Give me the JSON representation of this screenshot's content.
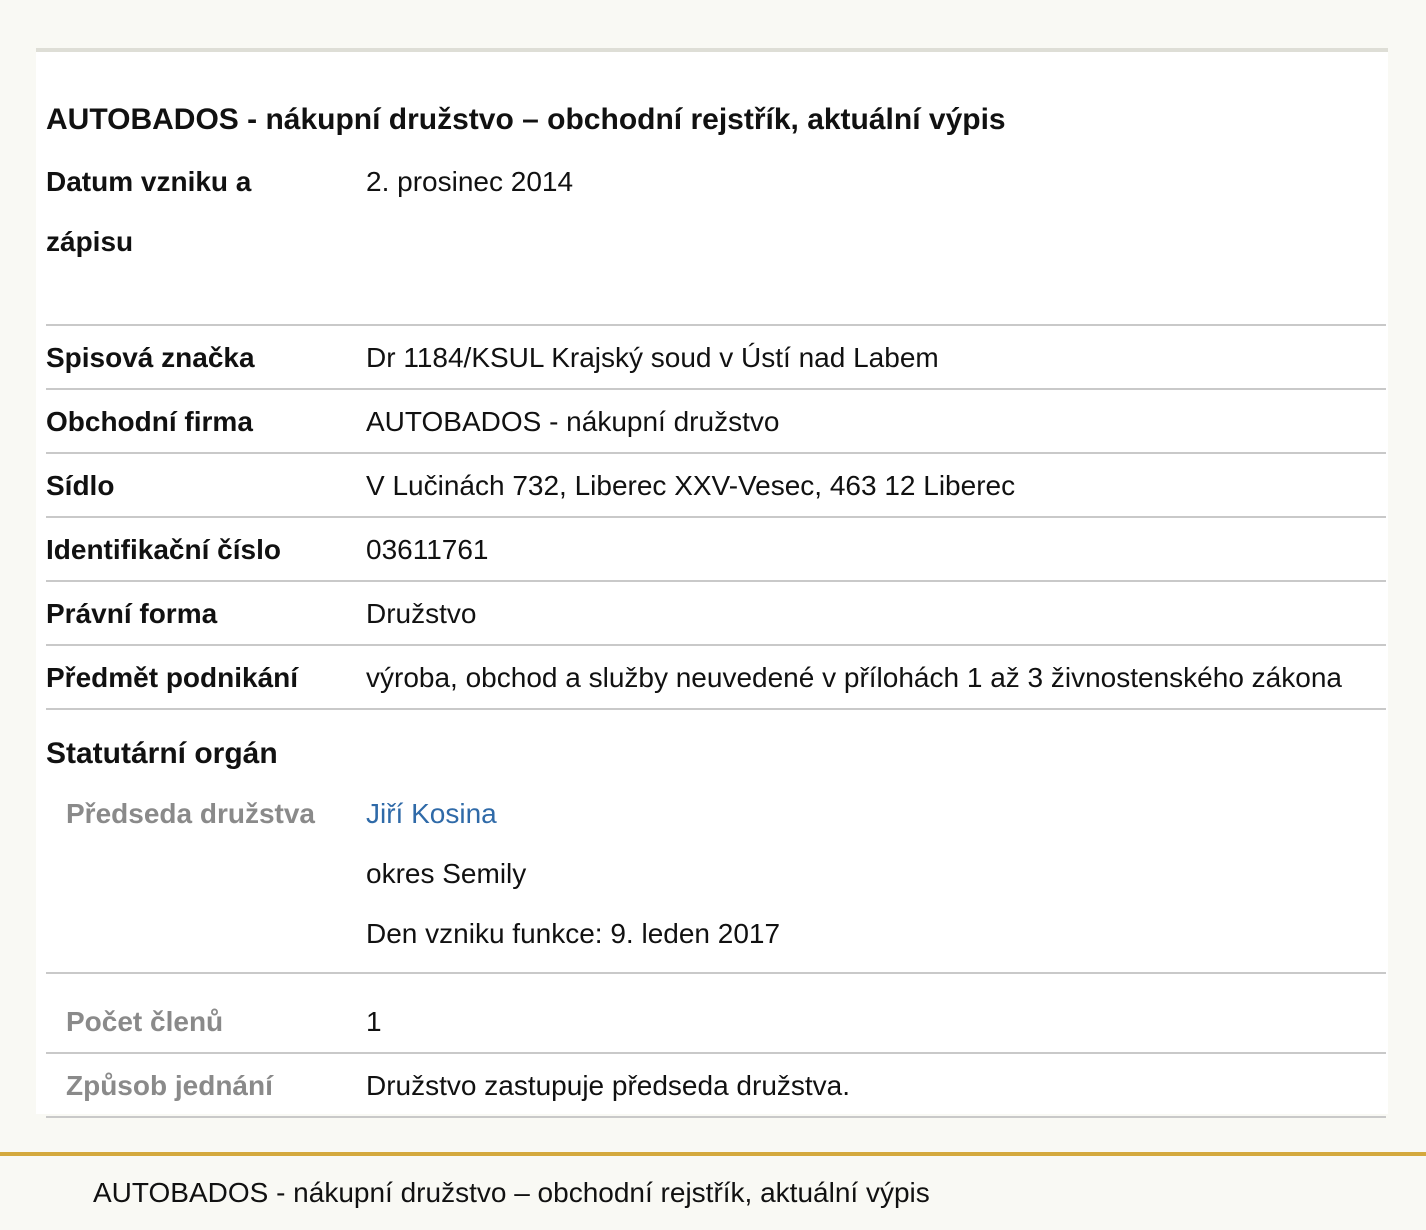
{
  "title": "AUTOBADOS - nákupní družstvo – obchodní rejstřík, aktuální výpis",
  "rows": [
    {
      "label": "Datum vzniku a zápisu",
      "value": "2. prosinec 2014"
    },
    {
      "label": "Spisová značka",
      "value": "Dr 1184/KSUL Krajský soud v Ústí nad Labem"
    },
    {
      "label": "Obchodní firma",
      "value": "AUTOBADOS - nákupní družstvo"
    },
    {
      "label": "Sídlo",
      "value": "V Lučinách 732, Liberec XXV-Vesec, 463 12 Liberec"
    },
    {
      "label": "Identifikační číslo",
      "value": "03611761"
    },
    {
      "label": "Právní forma",
      "value": "Družstvo"
    },
    {
      "label": "Předmět podnikání",
      "value": "výroba, obchod a služby neuvedené v přílohách 1 až 3 živnostenského zákona"
    }
  ],
  "statutory": {
    "title": "Statutární orgán",
    "chairman": {
      "label": "Předseda družstva",
      "name": "Jiří Kosina",
      "district": "okres Semily",
      "since": "Den vzniku funkce: 9. leden 2017"
    },
    "members": {
      "label": "Počet členů",
      "value": "1"
    },
    "conduct": {
      "label": "Způsob jednání",
      "value": "Družstvo zastupuje předseda družstva."
    }
  },
  "footer": {
    "text": "AUTOBADOS - nákupní družstvo – obchodní rejstřík, aktuální výpis"
  },
  "colors": {
    "link": "#2f6aa8",
    "footer_rule": "#d4a93d",
    "muted_label": "#8a8a8a"
  }
}
